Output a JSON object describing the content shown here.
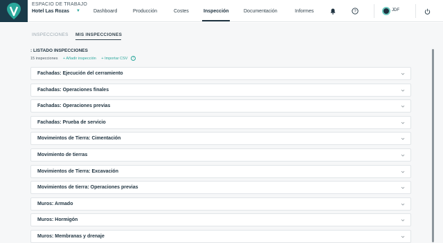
{
  "workspace": {
    "label": "ESPACIO DE TRABAJO",
    "name": "Hotel Las Rozas"
  },
  "nav": {
    "dashboard": "Dashboard",
    "produccion": "Producción",
    "costes": "Costes",
    "inspeccion": "Inspección",
    "documentacion": "Documentación",
    "informes": "Informes"
  },
  "user": {
    "initials": "JDF"
  },
  "subtabs": {
    "inspecciones": "INSPECCIONES",
    "mis_inspecciones": "MIS INSPECCIONES"
  },
  "list": {
    "title": ": LISTADO INSPECCIONES",
    "count": "15 inspecciones",
    "add_label": "+ Añadir inspección",
    "import_label": "+ Importar CSV",
    "help": "?"
  },
  "items": [
    "Fachadas: Ejecución del cerramiento",
    "Fachadas: Operaciones finales",
    "Fachadas: Operaciones previas",
    "Fachadas: Prueba de servicio",
    "Movimeintos de Tierra: Cimentación",
    "Movimiento de tierras",
    "Movimientos de Tierra: Excavación",
    "Movimientos de tierra: Operaciones previas",
    "Muros: Armado",
    "Muros: Hormigón",
    "Muros: Membranas y drenaje"
  ],
  "colors": {
    "accent": "#2aa79b",
    "dark": "#1f3340",
    "logo_bg": "#1a3a49"
  },
  "icons": [
    "logo-icon",
    "chevron-down-icon",
    "bell-icon",
    "help-icon",
    "power-icon"
  ]
}
